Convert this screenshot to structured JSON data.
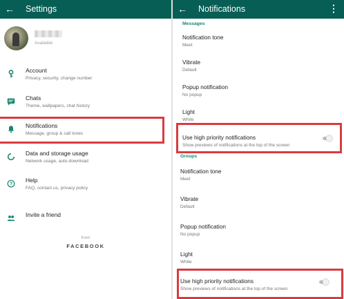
{
  "settings": {
    "title": "Settings",
    "profile": {
      "status": "Available"
    },
    "items": [
      {
        "label": "Account",
        "sub": "Privacy, security, change number",
        "icon": "key-icon"
      },
      {
        "label": "Chats",
        "sub": "Theme, wallpapers, chat history",
        "icon": "chat-icon"
      },
      {
        "label": "Notifications",
        "sub": "Message, group & call tones",
        "icon": "bell-icon"
      },
      {
        "label": "Data and storage usage",
        "sub": "Network usage, auto-download",
        "icon": "data-usage-icon"
      },
      {
        "label": "Help",
        "sub": "FAQ, contact us, privacy policy",
        "icon": "help-icon"
      },
      {
        "label": "Invite a friend",
        "sub": "",
        "icon": "people-icon"
      }
    ],
    "footer": {
      "from": "from",
      "brand": "FACEBOOK"
    }
  },
  "notifications": {
    "title": "Notifications",
    "messages": {
      "header": "Messages",
      "tone": {
        "label": "Notification tone",
        "value": "Meet"
      },
      "vibrate": {
        "label": "Vibrate",
        "value": "Default"
      },
      "popup": {
        "label": "Popup notification",
        "value": "No popup"
      },
      "light": {
        "label": "Light",
        "value": "White"
      },
      "high_priority": {
        "label": "Use high priority notifications",
        "sub": "Show previews of notifications at the top of the screen",
        "enabled": false
      }
    },
    "groups": {
      "header": "Groups",
      "tone": {
        "label": "Notification tone",
        "value": "Meet"
      },
      "vibrate": {
        "label": "Vibrate",
        "value": "Default"
      },
      "popup": {
        "label": "Popup notification",
        "value": "No popup"
      },
      "light": {
        "label": "Light",
        "value": "White"
      },
      "high_priority": {
        "label": "Use high priority notifications",
        "sub": "Show previews of notifications at the top of the screen",
        "enabled": false
      }
    }
  },
  "colors": {
    "appbar": "#075e54",
    "accent": "#14866d",
    "icon": "#14866d",
    "highlight": "#d93a3f"
  }
}
